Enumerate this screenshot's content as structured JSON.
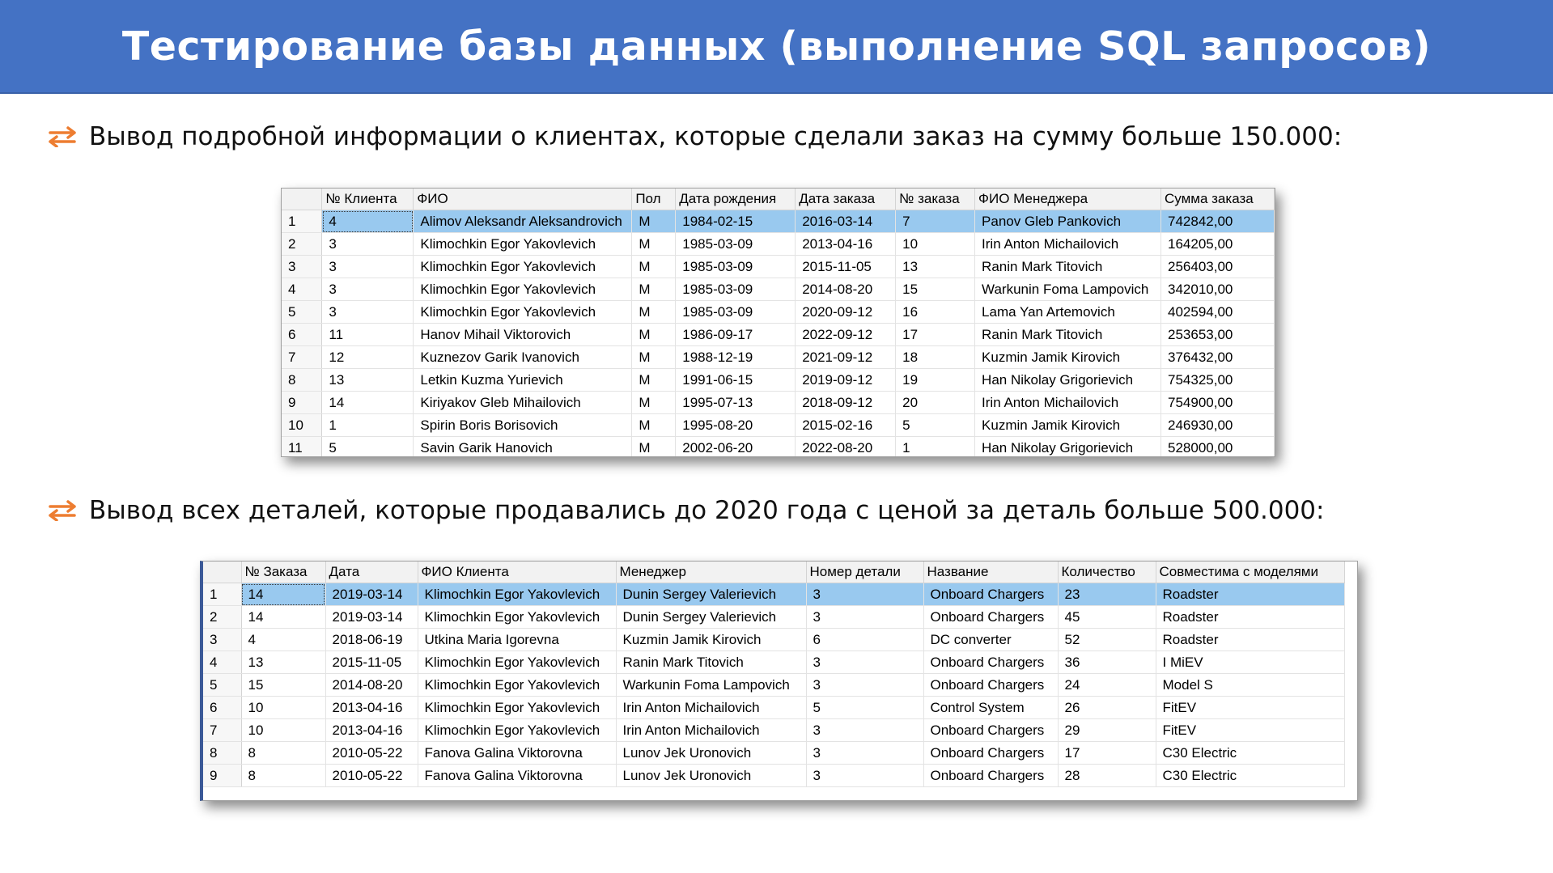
{
  "title": "Тестирование базы данных (выполнение SQL запросов)",
  "colors": {
    "title_bg": "#4472c4",
    "bullet_arrow": "#ed7d31",
    "selected_row": "#99c9ef"
  },
  "bullet1": {
    "icon": "swap-arrows-icon",
    "text": "Вывод подробной информации о клиентах, которые сделали заказ на сумму больше 150.000:"
  },
  "bullet2": {
    "icon": "swap-arrows-icon",
    "text": "Вывод всех деталей, которые продавались до 2020 года с ценой за деталь больше 500.000:"
  },
  "table1": {
    "headers": [
      "",
      "№ Клиента",
      "ФИО",
      "Пол",
      "Дата рождения",
      "Дата заказа",
      "№ заказа",
      "ФИО Менеджера",
      "Сумма заказа"
    ],
    "rows": [
      [
        "1",
        "4",
        "Alimov Aleksandr Aleksandrovich",
        "M",
        "1984-02-15",
        "2016-03-14",
        "7",
        "Panov Gleb Pankovich",
        "742842,00"
      ],
      [
        "2",
        "3",
        "Klimochkin Egor Yakovlevich",
        "M",
        "1985-03-09",
        "2013-04-16",
        "10",
        "Irin Anton Michailovich",
        "164205,00"
      ],
      [
        "3",
        "3",
        "Klimochkin Egor Yakovlevich",
        "M",
        "1985-03-09",
        "2015-11-05",
        "13",
        "Ranin Mark Titovich",
        "256403,00"
      ],
      [
        "4",
        "3",
        "Klimochkin Egor Yakovlevich",
        "M",
        "1985-03-09",
        "2014-08-20",
        "15",
        "Warkunin Foma Lampovich",
        "342010,00"
      ],
      [
        "5",
        "3",
        "Klimochkin Egor Yakovlevich",
        "M",
        "1985-03-09",
        "2020-09-12",
        "16",
        "Lama Yan Artemovich",
        "402594,00"
      ],
      [
        "6",
        "11",
        "Hanov Mihail Viktorovich",
        "M",
        "1986-09-17",
        "2022-09-12",
        "17",
        "Ranin Mark Titovich",
        "253653,00"
      ],
      [
        "7",
        "12",
        "Kuznezov Garik Ivanovich",
        "M",
        "1988-12-19",
        "2021-09-12",
        "18",
        "Kuzmin Jamik Kirovich",
        "376432,00"
      ],
      [
        "8",
        "13",
        "Letkin Kuzma Yurievich",
        "M",
        "1991-06-15",
        "2019-09-12",
        "19",
        "Han Nikolay Grigorievich",
        "754325,00"
      ],
      [
        "9",
        "14",
        "Kiriyakov Gleb Mihailovich",
        "M",
        "1995-07-13",
        "2018-09-12",
        "20",
        "Irin Anton Michailovich",
        "754900,00"
      ],
      [
        "10",
        "1",
        "Spirin Boris Borisovich",
        "M",
        "1995-08-20",
        "2015-02-16",
        "5",
        "Kuzmin Jamik Kirovich",
        "246930,00"
      ],
      [
        "11",
        "5",
        "Savin Garik Hanovich",
        "M",
        "2002-06-20",
        "2022-08-20",
        "1",
        "Han Nikolay Grigorievich",
        "528000,00"
      ]
    ]
  },
  "table2": {
    "headers": [
      "",
      "№ Заказа",
      "Дата",
      "ФИО Клиента",
      "Менеджер",
      "Номер детали",
      "Название",
      "Количество",
      "Совместима с моделями"
    ],
    "rows": [
      [
        "1",
        "14",
        "2019-03-14",
        "Klimochkin Egor Yakovlevich",
        "Dunin Sergey Valerievich",
        "3",
        "Onboard Chargers",
        "23",
        "Roadster"
      ],
      [
        "2",
        "14",
        "2019-03-14",
        "Klimochkin Egor Yakovlevich",
        "Dunin Sergey Valerievich",
        "3",
        "Onboard Chargers",
        "45",
        "Roadster"
      ],
      [
        "3",
        "4",
        "2018-06-19",
        "Utkina Maria Igorevna",
        "Kuzmin Jamik Kirovich",
        "6",
        " DC converter",
        "52",
        "Roadster"
      ],
      [
        "4",
        "13",
        "2015-11-05",
        "Klimochkin Egor Yakovlevich",
        "Ranin Mark Titovich",
        "3",
        "Onboard Chargers",
        "36",
        "I MiEV"
      ],
      [
        "5",
        "15",
        "2014-08-20",
        "Klimochkin Egor Yakovlevich",
        "Warkunin Foma Lampovich",
        "3",
        "Onboard Chargers",
        "24",
        "Model S"
      ],
      [
        "6",
        "10",
        "2013-04-16",
        "Klimochkin Egor Yakovlevich",
        "Irin Anton Michailovich",
        "5",
        "Control System",
        "26",
        "FitEV"
      ],
      [
        "7",
        "10",
        "2013-04-16",
        "Klimochkin Egor Yakovlevich",
        "Irin Anton Michailovich",
        "3",
        "Onboard Chargers",
        "29",
        "FitEV"
      ],
      [
        "8",
        "8",
        "2010-05-22",
        "Fanova Galina Viktorovna",
        "Lunov Jek Uronovich",
        "3",
        "Onboard Chargers",
        "17",
        "C30 Electric"
      ],
      [
        "9",
        "8",
        "2010-05-22",
        "Fanova Galina Viktorovna",
        "Lunov Jek Uronovich",
        "3",
        "Onboard Chargers",
        "28",
        "C30 Electric"
      ]
    ]
  }
}
